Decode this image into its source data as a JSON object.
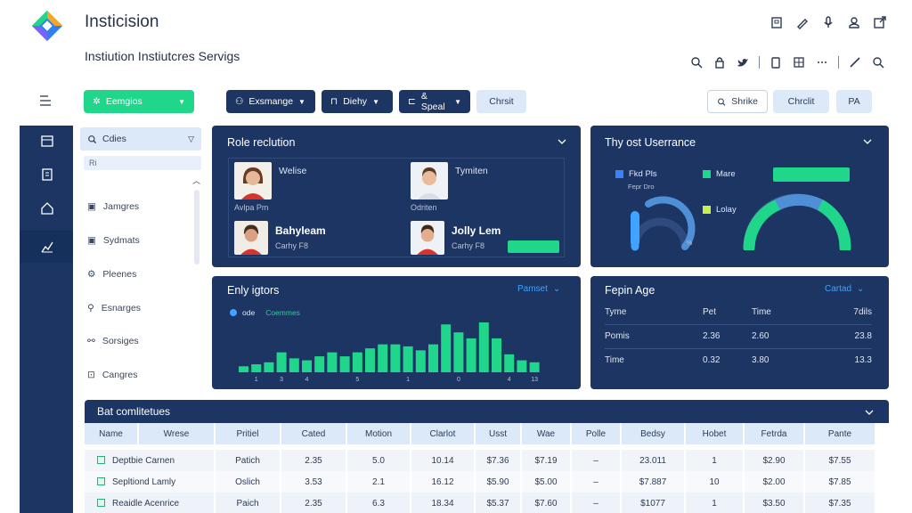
{
  "header": {
    "app_title": "Insticision",
    "subtitle": "Instiution Instiutcres Servigs",
    "top_icons": [
      "building-icon",
      "pen-icon",
      "mic-icon",
      "user-icon",
      "share-icon"
    ],
    "tool_icons": [
      "search-icon",
      "lock-icon",
      "twitter-icon",
      "clipboard-icon",
      "grid-icon",
      "more-icon",
      "pencil-icon",
      "search-icon"
    ]
  },
  "toolbar": {
    "primary_select": "Eemgios",
    "filters": [
      {
        "label": "Exsmange",
        "icon": "user-group-icon"
      },
      {
        "label": "Diehy",
        "icon": "lock-icon"
      },
      {
        "label": "& Speal",
        "icon": "tag-icon"
      }
    ],
    "chart_button": "Chrsit",
    "search_label": "Shrike",
    "check_button": "Chrclit",
    "pa_button": "PA"
  },
  "sidebar": {
    "search_label": "Cdies",
    "filter_value": "Ri",
    "items": [
      {
        "label": "Jamgres",
        "icon": "calendar-icon"
      },
      {
        "label": "Sydmats",
        "icon": "calendar-icon"
      },
      {
        "label": "Pleenes",
        "icon": "gear-icon"
      },
      {
        "label": "Esnarges",
        "icon": "key-icon"
      },
      {
        "label": "Sorsiges",
        "icon": "link-icon"
      },
      {
        "label": "Cangres",
        "icon": "camera-icon"
      }
    ]
  },
  "role_panel": {
    "title": "Role reclution",
    "people": [
      {
        "name": "Welise",
        "role": "Avlpa Pm"
      },
      {
        "name": "Tymiten",
        "role": "Odriten"
      },
      {
        "name": "Bahyleam",
        "role": "Carhy F8"
      },
      {
        "name": "Jolly Lem",
        "role": "Carhy F8"
      }
    ]
  },
  "usage_panel": {
    "title": "Thy ost Userrance",
    "legend": [
      {
        "label": "Fkd Pls",
        "sub": "Fepr Dro",
        "color": "#3b82f6"
      },
      {
        "label": "Mare",
        "color": "#20d68a"
      },
      {
        "label": "Lolay",
        "color": "#c6f04a"
      }
    ],
    "gauge_label": "%",
    "small_gauge_value": 0.45,
    "large_gauge_value": 0.62
  },
  "early_panel": {
    "title": "Enly igtors",
    "link": "Pamset",
    "legend_a": "ode",
    "legend_b": "Coemmes"
  },
  "age_panel": {
    "title": "Fepin Age",
    "link": "Cartad",
    "columns": [
      "Tyme",
      "Pet",
      "Time",
      "7dils"
    ],
    "rows": [
      [
        "Pomis",
        "2.36",
        "2.60",
        "23.8"
      ],
      [
        "Time",
        "0.32",
        "3.80",
        "13.3"
      ]
    ]
  },
  "chart_data": {
    "type": "bar",
    "x_tick_labels": [
      "1",
      "3",
      "4",
      "5",
      "1",
      "0",
      "4",
      "13"
    ],
    "values": [
      3,
      4,
      5,
      10,
      7,
      6,
      8,
      10,
      8,
      10,
      12,
      14,
      14,
      13,
      11,
      14,
      24,
      20,
      17,
      25,
      17,
      9,
      6,
      5
    ],
    "series": [
      {
        "name": "Coemmes",
        "color": "#20d68a"
      }
    ]
  },
  "bottom_table": {
    "title": "Bat comlitetues",
    "columns": [
      "Name",
      "Wrese",
      "Pritiel",
      "Cated",
      "Motion",
      "Clarlot",
      "Usst",
      "Wae",
      "Polle",
      "Bedsy",
      "Hobet",
      "Fetrda",
      "Pante"
    ],
    "rows": [
      [
        "Deptbie Carnen",
        "Patich",
        "2.35",
        "5.0",
        "10.14",
        "$7.36",
        "$7.19",
        "–",
        "23.011",
        "1",
        "$2.90",
        "$7.55"
      ],
      [
        "Sepltiond Lamly",
        "Oslich",
        "3.53",
        "2.1",
        "16.12",
        "$5.90",
        "$5.00",
        "–",
        "$7.887",
        "10",
        "$2.00",
        "$7.85"
      ],
      [
        "Reaidle Acenrice",
        "Paich",
        "2.35",
        "6.3",
        "18.34",
        "$5.37",
        "$7.60",
        "–",
        "$1077",
        "1",
        "$3.50",
        "$7.35"
      ]
    ]
  }
}
